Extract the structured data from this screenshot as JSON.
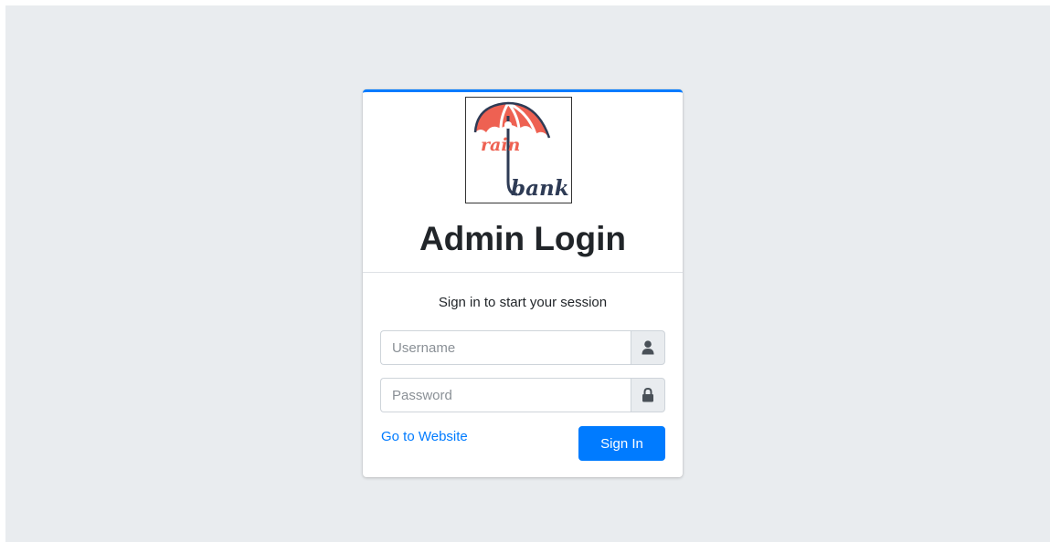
{
  "login": {
    "title": "Admin Login",
    "message": "Sign in to start your session",
    "username_placeholder": "Username",
    "username_value": "",
    "password_placeholder": "Password",
    "password_value": "",
    "website_link": "Go to Website",
    "signin_label": "Sign In"
  },
  "logo": {
    "text_top": "rain",
    "text_bottom": "bank",
    "icon": "umbrella-logo-icon"
  },
  "icons": {
    "username": "user-icon",
    "password": "lock-icon"
  },
  "colors": {
    "background": "#e9ecef",
    "accent": "#007bff",
    "logo_red": "#ee6152",
    "logo_navy": "#2e3b55"
  }
}
